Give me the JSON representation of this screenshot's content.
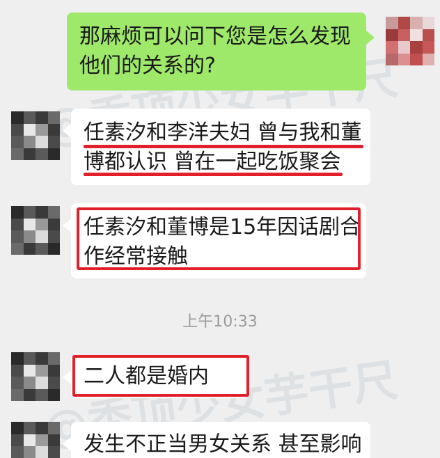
{
  "messages": [
    {
      "id": "m1",
      "side": "out",
      "lines": [
        "那麻烦可以问下您是怎么发现",
        "他们的关系的?"
      ]
    },
    {
      "id": "m2",
      "side": "in",
      "lines": [
        "任素汐和李洋夫妇 曾与我和董",
        "博都认识 曾在一起吃饭聚会"
      ]
    },
    {
      "id": "m3",
      "side": "in",
      "lines": [
        "任素汐和董博是15年因话剧合",
        "作经常接触"
      ]
    },
    {
      "id": "m4",
      "side": "in",
      "lines": [
        "二人都是婚内"
      ]
    },
    {
      "id": "m5",
      "side": "in",
      "lines": [
        "发生不正当男女关系 甚至影响"
      ]
    }
  ],
  "timestamp": "上午10:33",
  "watermark": {
    "text_top": "@秃顶少女芋干尺",
    "text_bottom": "@秃顶少女芋干尺"
  },
  "colors": {
    "background": "#efefef",
    "outgoing_bubble": "#9ee86a",
    "incoming_bubble": "#ffffff",
    "highlight_red": "#e0202a"
  }
}
